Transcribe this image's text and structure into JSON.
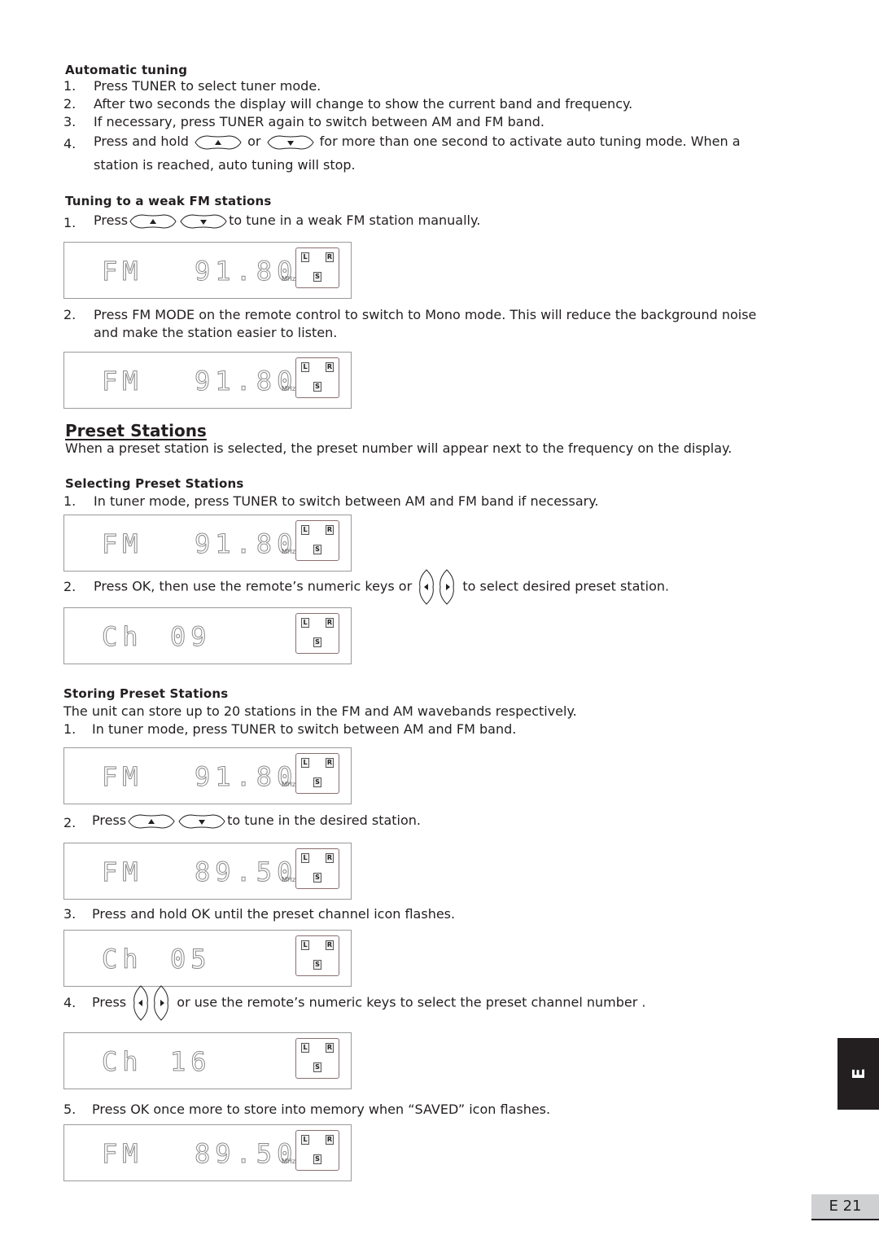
{
  "auto_tuning": {
    "heading": "Automatic tuning",
    "steps": [
      {
        "n": "1.",
        "text": "Press TUNER to select tuner mode."
      },
      {
        "n": "2.",
        "text": "After two seconds the display will change to show the current band and frequency."
      },
      {
        "n": "3.",
        "text": "If necessary, press TUNER again to switch between AM and FM band."
      },
      {
        "n": "4.",
        "pre": "Press and hold",
        "mid": "or",
        "post": "for more than one second to activate auto tuning mode.  When a",
        "cont": "station is reached, auto tuning will stop."
      }
    ]
  },
  "weak_fm": {
    "heading": "Tuning to a weak FM stations",
    "step1": {
      "n": "1.",
      "pre": "Press",
      "post": "to tune in a weak FM station manually."
    },
    "step2": {
      "n": "2.",
      "text": "Press FM MODE on the remote control to switch to Mono mode.  This will reduce the background noise",
      "cont": "and make the station easier to listen."
    }
  },
  "preset": {
    "title": "Preset Stations",
    "intro": "When a preset station is selected, the preset number will appear next to the frequency on the display.",
    "selecting": {
      "heading": "Selecting Preset Stations",
      "step1": {
        "n": "1.",
        "text": "In tuner mode, press TUNER to switch between AM and FM band if necessary."
      },
      "step2": {
        "n": "2.",
        "pre": "Press OK, then use the remote’s numeric keys or",
        "post": "to select desired preset station."
      }
    },
    "storing": {
      "heading": "Storing Preset Stations",
      "intro": "The unit can store up to 20 stations in the FM and AM wavebands respectively.",
      "step1": {
        "n": "1.",
        "text": "In tuner mode, press TUNER to switch between AM and FM band."
      },
      "step2": {
        "n": "2.",
        "pre": "Press",
        "post": "to tune in the desired station."
      },
      "step3": {
        "n": "3.",
        "text": "Press and hold OK until the preset channel icon flashes."
      },
      "step4": {
        "n": "4.",
        "pre": "Press",
        "post": "or use the remote’s numeric keys to select the preset channel number ."
      },
      "step5": {
        "n": "5.",
        "text": "Press OK once more to store into memory when “SAVED” icon flashes."
      }
    }
  },
  "displays": [
    {
      "band": "FM",
      "value": "91.80",
      "unit": "MHz"
    },
    {
      "band": "FM",
      "value": "91.80",
      "unit": "MHz"
    },
    {
      "band": "FM",
      "value": "91.80",
      "unit": "MHz"
    },
    {
      "band": "Ch",
      "value": "09",
      "unit": ""
    },
    {
      "band": "FM",
      "value": "91.80",
      "unit": "MHz"
    },
    {
      "band": "FM",
      "value": "89.50",
      "unit": "MHz"
    },
    {
      "band": "Ch",
      "value": "05",
      "unit": ""
    },
    {
      "band": "Ch",
      "value": "16",
      "unit": ""
    },
    {
      "band": "FM",
      "value": "89.50",
      "unit": "MHz"
    }
  ],
  "indicators": {
    "left": "L",
    "right": "R",
    "stereo": "S"
  },
  "side_tab": "E",
  "page_number": "E 21"
}
